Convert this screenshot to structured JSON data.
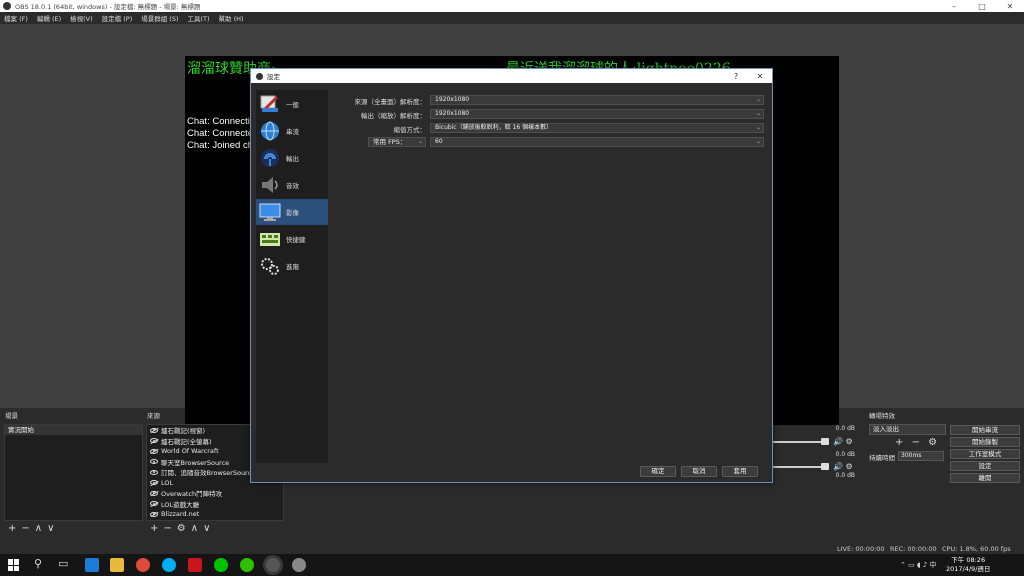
{
  "window": {
    "title": "OBS 18.0.1 (64bit, windows) - 設定檔: 無標題 - 場景: 無標題",
    "minimize": "–",
    "maximize": "□",
    "close": "✕"
  },
  "menu": [
    "檔案 (F)",
    "編輯 (E)",
    "檢視(V)",
    "設定檔 (P)",
    "場景群組 (S)",
    "工具(T)",
    "幫助 (H)"
  ],
  "preview": {
    "sponsor_text": "溜溜球贊助商:",
    "recent_text": "最近送我溜溜球的人:lightneo0226",
    "chat_lines": [
      "Chat: Connecti",
      "Chat: Connecte",
      "Chat: Joined ch"
    ]
  },
  "scenes": {
    "label": "場景",
    "items": [
      "實況開始"
    ]
  },
  "sources": {
    "label": "來源",
    "items": [
      {
        "name": "爐石戰記(視窗)",
        "hidden": true
      },
      {
        "name": "爐石戰記(全螢幕)",
        "hidden": true
      },
      {
        "name": "World Of Warcraft",
        "hidden": true
      },
      {
        "name": "聊天室BrowserSource",
        "hidden": false
      },
      {
        "name": "訂閱、追隨音效BrowserSource",
        "hidden": false
      },
      {
        "name": "LOL",
        "hidden": true
      },
      {
        "name": "Overwatch鬥陣特攻",
        "hidden": true
      },
      {
        "name": "LOL遊戲大廳",
        "hidden": true
      },
      {
        "name": "Blizzard.net",
        "hidden": true
      }
    ]
  },
  "toolbar_glyphs": {
    "add": "+",
    "remove": "−",
    "up": "∧",
    "down": "∨",
    "gear": "⚙"
  },
  "mixer": {
    "channels": [
      {
        "db": "0.0 dB"
      },
      {
        "db": "0.0 dB"
      },
      {
        "db": "0.0 dB"
      }
    ],
    "speaker": "🔊",
    "gear": "⚙"
  },
  "transitions": {
    "label": "轉場特效",
    "selected": "淡入淡出",
    "duration_label": "持續時間",
    "duration_value": "300ms"
  },
  "controls": [
    "開始串流",
    "開始錄製",
    "工作室模式",
    "設定",
    "離開"
  ],
  "status": {
    "live": "LIVE: 00:00:00",
    "rec": "REC: 00:00:00",
    "cpu": "CPU: 1.8%, 60.00 fps"
  },
  "taskbar": {
    "clock_time": "下午 08:26",
    "clock_date": "2017/4/9/週日"
  },
  "dialog": {
    "title": "設定",
    "help": "?",
    "close": "✕",
    "sidebar": [
      "一般",
      "串流",
      "輸出",
      "音效",
      "影像",
      "快捷鍵",
      "進階"
    ],
    "active_index": 4,
    "fields": {
      "base_label": "來源（全畫面）解析度：",
      "base_value": "1920x1080",
      "output_label": "輸出（縮放）解析度：",
      "output_value": "1920x1080",
      "filter_label": "縮值方式：",
      "filter_value": "Bicubic（鋪放後較銳利，取 16 個樣本數）",
      "fps_type": "常用 FPS：",
      "fps_value": "60"
    },
    "buttons": [
      "確定",
      "取消",
      "套用"
    ]
  }
}
